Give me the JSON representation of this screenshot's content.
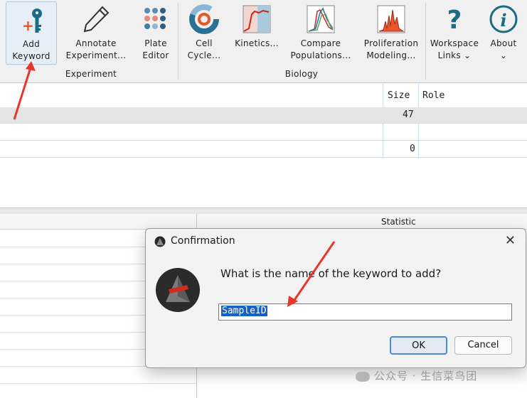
{
  "ribbon": {
    "buttons": [
      {
        "label1": "Add",
        "label2": "Keyword"
      },
      {
        "label1": "Annotate",
        "label2": "Experiment..."
      },
      {
        "label1": "Plate",
        "label2": "Editor"
      },
      {
        "label1": "Cell",
        "label2": "Cycle..."
      },
      {
        "label1": "Kinetics...",
        "label2": ""
      },
      {
        "label1": "Compare",
        "label2": "Populations..."
      },
      {
        "label1": "Proliferation",
        "label2": "Modeling..."
      },
      {
        "label1": "Workspace",
        "label2": "Links"
      },
      {
        "label1": "About",
        "label2": ""
      }
    ],
    "groups": {
      "experiment": "Experiment",
      "biology": "Biology"
    }
  },
  "table": {
    "headers": {
      "size": "Size",
      "role": "Role"
    },
    "rows": [
      {
        "size": "47"
      },
      {
        "size": ""
      },
      {
        "size": "0"
      }
    ]
  },
  "lower": {
    "statistic_header": "Statistic"
  },
  "dialog": {
    "title": "Confirmation",
    "message": "What is the name of the keyword to add?",
    "input_value": "SampleID",
    "ok_label": "OK",
    "cancel_label": "Cancel"
  },
  "watermark": "公众号 · 生信菜鸟团",
  "colors": {
    "accent": "#1662c4",
    "annotation_arrow": "#e8372a",
    "key_icon": "#1b6a86"
  }
}
